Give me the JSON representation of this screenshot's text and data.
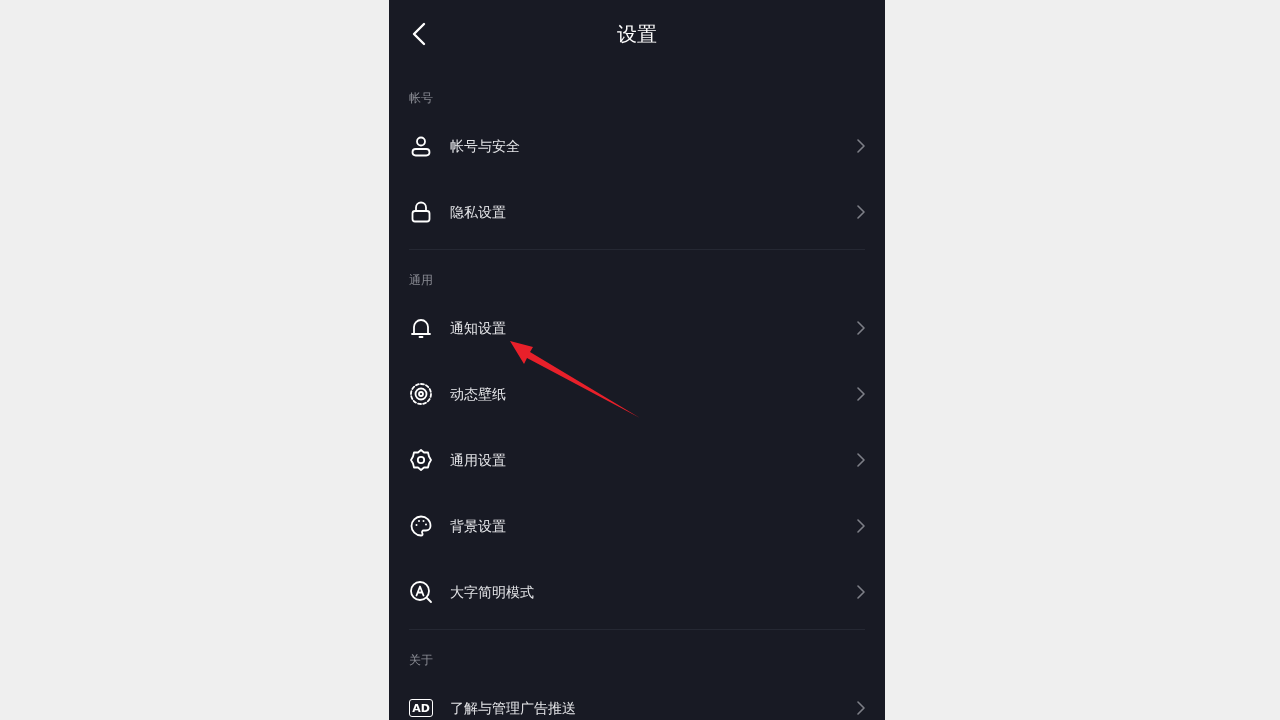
{
  "header": {
    "title": "设置"
  },
  "sections": [
    {
      "label": "帐号",
      "items": [
        {
          "label": "帐号与安全"
        },
        {
          "label": "隐私设置"
        }
      ]
    },
    {
      "label": "通用",
      "items": [
        {
          "label": "通知设置"
        },
        {
          "label": "动态壁纸"
        },
        {
          "label": "通用设置"
        },
        {
          "label": "背景设置"
        },
        {
          "label": "大字简明模式"
        }
      ]
    },
    {
      "label": "关于",
      "items": [
        {
          "icon_label": "AD",
          "label": "了解与管理广告推送"
        }
      ]
    }
  ]
}
